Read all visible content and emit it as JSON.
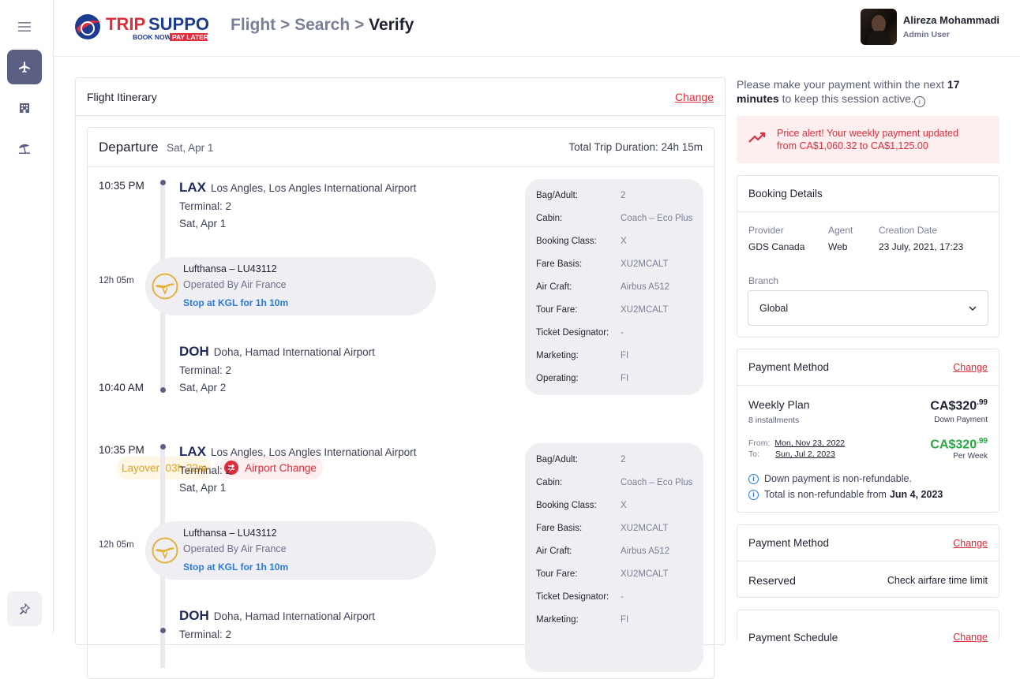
{
  "app": {
    "brand": {
      "name": "TRIP SUPPORT",
      "tagline_a": "BOOK NOW",
      "tagline_b": "PAY LATER"
    },
    "sidebar": {
      "items": [
        {
          "icon": "hamburger-menu-icon"
        },
        {
          "icon": "airplane-icon",
          "active": true
        },
        {
          "icon": "hotel-icon"
        },
        {
          "icon": "beach-umbrella-icon"
        }
      ],
      "pin_icon": "pin-icon"
    },
    "breadcrumb": {
      "part1": "Flight",
      "sep": ">",
      "part2": "Search",
      "current": "Verify"
    },
    "user": {
      "name": "Alireza Mohammadi",
      "role": "Admin User"
    }
  },
  "itinerary": {
    "title": "Flight Itinerary",
    "change_label": "Change",
    "departure": {
      "title": "Departure",
      "date": "Sat, Apr 1",
      "total_duration": "Total Trip Duration: 24h 15m"
    },
    "segments": [
      {
        "dep_time": "10:35 PM",
        "from_code": "LAX",
        "from_name": "Los Angles, Los Angles International Airport",
        "from_terminal": "Terminal: 2",
        "from_date": "Sat, Apr 1",
        "duration": "12h 05m",
        "carrier": "Lufthansa – LU43112",
        "operated": "Operated By Air France",
        "stop": "Stop at KGL for 1h 10m",
        "arr_time": "10:40 AM",
        "to_code": "DOH",
        "to_name": "Doha, Hamad International Airport",
        "to_terminal": "Terminal: 2",
        "to_date": "Sat, Apr 2",
        "details": [
          {
            "label": "Bag/Adult:",
            "value": "2"
          },
          {
            "label": "Cabin:",
            "value": "Coach – Eco Plus"
          },
          {
            "label": "Booking Class:",
            "value": "X"
          },
          {
            "label": "Fare Basis:",
            "value": "XU2MCALT"
          },
          {
            "label": "Air Craft:",
            "value": "Airbus A512"
          },
          {
            "label": "Tour Fare:",
            "value": "XU2MCALT"
          },
          {
            "label": "Ticket Designator:",
            "value": "-"
          },
          {
            "label": "Marketing:",
            "value": "FI"
          },
          {
            "label": "Operating:",
            "value": "FI"
          }
        ]
      },
      {
        "dep_time": "10:35 PM",
        "from_code": "LAX",
        "from_name": "Los Angles, Los Angles International Airport",
        "from_terminal": "Terminal: 2",
        "from_date": "Sat, Apr 1",
        "duration": "12h 05m",
        "carrier": "Lufthansa – LU43112",
        "operated": "Operated By Air France",
        "stop": "Stop at KGL for 1h 10m",
        "to_code": "DOH",
        "to_name": "Doha, Hamad International Airport",
        "to_terminal": "Terminal: 2",
        "details": [
          {
            "label": "Bag/Adult:",
            "value": "2"
          },
          {
            "label": "Cabin:",
            "value": "Coach – Eco Plus"
          },
          {
            "label": "Booking Class:",
            "value": "X"
          },
          {
            "label": "Fare Basis:",
            "value": "XU2MCALT"
          },
          {
            "label": "Air Craft:",
            "value": "Airbus A512"
          },
          {
            "label": "Tour Fare:",
            "value": "XU2MCALT"
          },
          {
            "label": "Ticket Designator:",
            "value": "-"
          },
          {
            "label": "Marketing:",
            "value": "FI"
          }
        ]
      }
    ],
    "layover": {
      "text": "Layover:  03h 22m",
      "airport_change": "Airport Change"
    }
  },
  "session": {
    "prefix": "Please make your payment within the next ",
    "minutes": "17 minutes",
    "suffix": " to keep this session active."
  },
  "price_alert": {
    "line1": "Price alert! Your weekly payment updated",
    "line2": "from CA$1,060.32 to CA$1,125.00",
    "color": "#e02d3c"
  },
  "booking_details": {
    "title": "Booking Details",
    "provider_label": "Provider",
    "provider": "GDS Canada",
    "agent_label": "Agent",
    "agent": "Web",
    "created_label": "Creation Date",
    "created": "23 July, 2021, 17:23",
    "branch_label": "Branch",
    "branch": "Global"
  },
  "payment_method": {
    "title": "Payment Method",
    "change_label": "Change",
    "plan": "Weekly Plan",
    "installments": "8 installments",
    "down_price": "CA$320",
    "down_cents": ".99",
    "down_label": "Down Payment",
    "week_price": "CA$320",
    "week_cents": ".99",
    "week_label": "Per Week",
    "from_label": "From:",
    "from_date": "Mon, Nov 23, 2022",
    "to_label": "To:",
    "to_date": "Sun, Jul 2, 2023",
    "note1": "Down payment is non-refundable.",
    "note2_prefix": "Total is non-refundable from",
    "note2_date": "Jun 4, 2023"
  },
  "payment_method2": {
    "title": "Payment Method",
    "change_label": "Change",
    "status": "Reserved",
    "action": "Check airfare time limit"
  },
  "payment_schedule": {
    "title": "Payment Schedule",
    "change_label": "Change"
  }
}
